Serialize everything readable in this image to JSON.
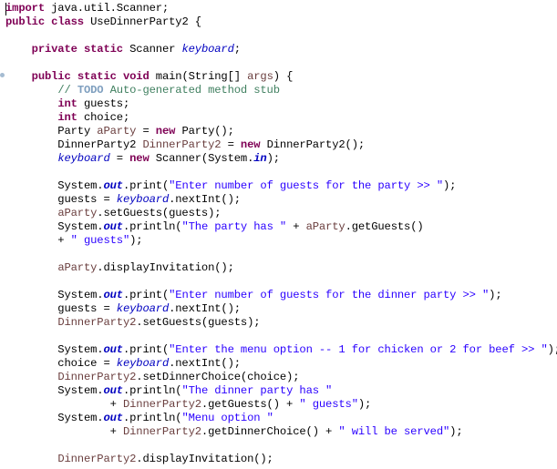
{
  "editor": {
    "language": "java",
    "colors": {
      "keyword": "#7f0055",
      "field": "#0000c0",
      "local_ref": "#6a3e3e",
      "string": "#2a00ff",
      "comment": "#3f7f5f",
      "todo": "#7f9fbf"
    },
    "lines": [
      [
        [
          "kw",
          "import"
        ],
        [
          "p",
          " java.util.Scanner;"
        ]
      ],
      [
        [
          "kw",
          "public"
        ],
        [
          "p",
          " "
        ],
        [
          "kw",
          "class"
        ],
        [
          "p",
          " UseDinnerParty2 {"
        ]
      ],
      [],
      [
        [
          "p",
          "    "
        ],
        [
          "kw",
          "private"
        ],
        [
          "p",
          " "
        ],
        [
          "kw",
          "static"
        ],
        [
          "p",
          " Scanner "
        ],
        [
          "fld",
          "keyboard"
        ],
        [
          "p",
          ";"
        ]
      ],
      [],
      [
        [
          "p",
          "    "
        ],
        [
          "kw",
          "public"
        ],
        [
          "p",
          " "
        ],
        [
          "kw",
          "static"
        ],
        [
          "p",
          " "
        ],
        [
          "kw",
          "void"
        ],
        [
          "p",
          " main(String[] "
        ],
        [
          "ref",
          "args"
        ],
        [
          "p",
          ") {"
        ]
      ],
      [
        [
          "p",
          "        "
        ],
        [
          "cm",
          "// "
        ],
        [
          "todo",
          "TODO"
        ],
        [
          "cm",
          " Auto-generated method stub"
        ]
      ],
      [
        [
          "p",
          "        "
        ],
        [
          "kw",
          "int"
        ],
        [
          "p",
          " guests;"
        ]
      ],
      [
        [
          "p",
          "        "
        ],
        [
          "kw",
          "int"
        ],
        [
          "p",
          " choice;"
        ]
      ],
      [
        [
          "p",
          "        Party "
        ],
        [
          "ref",
          "aParty"
        ],
        [
          "p",
          " = "
        ],
        [
          "kw",
          "new"
        ],
        [
          "p",
          " Party();"
        ]
      ],
      [
        [
          "p",
          "        DinnerParty2 "
        ],
        [
          "ref",
          "DinnerParty2"
        ],
        [
          "p",
          " = "
        ],
        [
          "kw",
          "new"
        ],
        [
          "p",
          " DinnerParty2();"
        ]
      ],
      [
        [
          "p",
          "        "
        ],
        [
          "fld",
          "keyboard"
        ],
        [
          "p",
          " = "
        ],
        [
          "kw",
          "new"
        ],
        [
          "p",
          " Scanner(System."
        ],
        [
          "sfld",
          "in"
        ],
        [
          "p",
          ");"
        ]
      ],
      [],
      [
        [
          "p",
          "        System."
        ],
        [
          "sfld",
          "out"
        ],
        [
          "p",
          ".print("
        ],
        [
          "str",
          "\"Enter number of guests for the party >> \""
        ],
        [
          "p",
          ");"
        ]
      ],
      [
        [
          "p",
          "        guests = "
        ],
        [
          "fld",
          "keyboard"
        ],
        [
          "p",
          ".nextInt();"
        ]
      ],
      [
        [
          "p",
          "        "
        ],
        [
          "ref",
          "aParty"
        ],
        [
          "p",
          ".setGuests(guests);"
        ]
      ],
      [
        [
          "p",
          "        System."
        ],
        [
          "sfld",
          "out"
        ],
        [
          "p",
          ".println("
        ],
        [
          "str",
          "\"The party has \""
        ],
        [
          "p",
          " + "
        ],
        [
          "ref",
          "aParty"
        ],
        [
          "p",
          ".getGuests()"
        ]
      ],
      [
        [
          "p",
          "        + "
        ],
        [
          "str",
          "\" guests\""
        ],
        [
          "p",
          ");"
        ]
      ],
      [],
      [
        [
          "p",
          "        "
        ],
        [
          "ref",
          "aParty"
        ],
        [
          "p",
          ".displayInvitation();"
        ]
      ],
      [],
      [
        [
          "p",
          "        System."
        ],
        [
          "sfld",
          "out"
        ],
        [
          "p",
          ".print("
        ],
        [
          "str",
          "\"Enter number of guests for the dinner party >> \""
        ],
        [
          "p",
          ");"
        ]
      ],
      [
        [
          "p",
          "        guests = "
        ],
        [
          "fld",
          "keyboard"
        ],
        [
          "p",
          ".nextInt();"
        ]
      ],
      [
        [
          "p",
          "        "
        ],
        [
          "ref",
          "DinnerParty2"
        ],
        [
          "p",
          ".setGuests(guests);"
        ]
      ],
      [],
      [
        [
          "p",
          "        System."
        ],
        [
          "sfld",
          "out"
        ],
        [
          "p",
          ".print("
        ],
        [
          "str",
          "\"Enter the menu option -- 1 for chicken or 2 for beef >> \""
        ],
        [
          "p",
          ");"
        ]
      ],
      [
        [
          "p",
          "        choice = "
        ],
        [
          "fld",
          "keyboard"
        ],
        [
          "p",
          ".nextInt();"
        ]
      ],
      [
        [
          "p",
          "        "
        ],
        [
          "ref",
          "DinnerParty2"
        ],
        [
          "p",
          ".setDinnerChoice(choice);"
        ]
      ],
      [
        [
          "p",
          "        System."
        ],
        [
          "sfld",
          "out"
        ],
        [
          "p",
          ".println("
        ],
        [
          "str",
          "\"The dinner party has \""
        ]
      ],
      [
        [
          "p",
          "                + "
        ],
        [
          "ref",
          "DinnerParty2"
        ],
        [
          "p",
          ".getGuests() + "
        ],
        [
          "str",
          "\" guests\""
        ],
        [
          "p",
          ");"
        ]
      ],
      [
        [
          "p",
          "        System."
        ],
        [
          "sfld",
          "out"
        ],
        [
          "p",
          ".println("
        ],
        [
          "str",
          "\"Menu option \""
        ]
      ],
      [
        [
          "p",
          "                + "
        ],
        [
          "ref",
          "DinnerParty2"
        ],
        [
          "p",
          ".getDinnerChoice() + "
        ],
        [
          "str",
          "\" will be served\""
        ],
        [
          "p",
          ");"
        ]
      ],
      [],
      [
        [
          "p",
          "        "
        ],
        [
          "ref",
          "DinnerParty2"
        ],
        [
          "p",
          ".displayInvitation();"
        ]
      ]
    ]
  }
}
